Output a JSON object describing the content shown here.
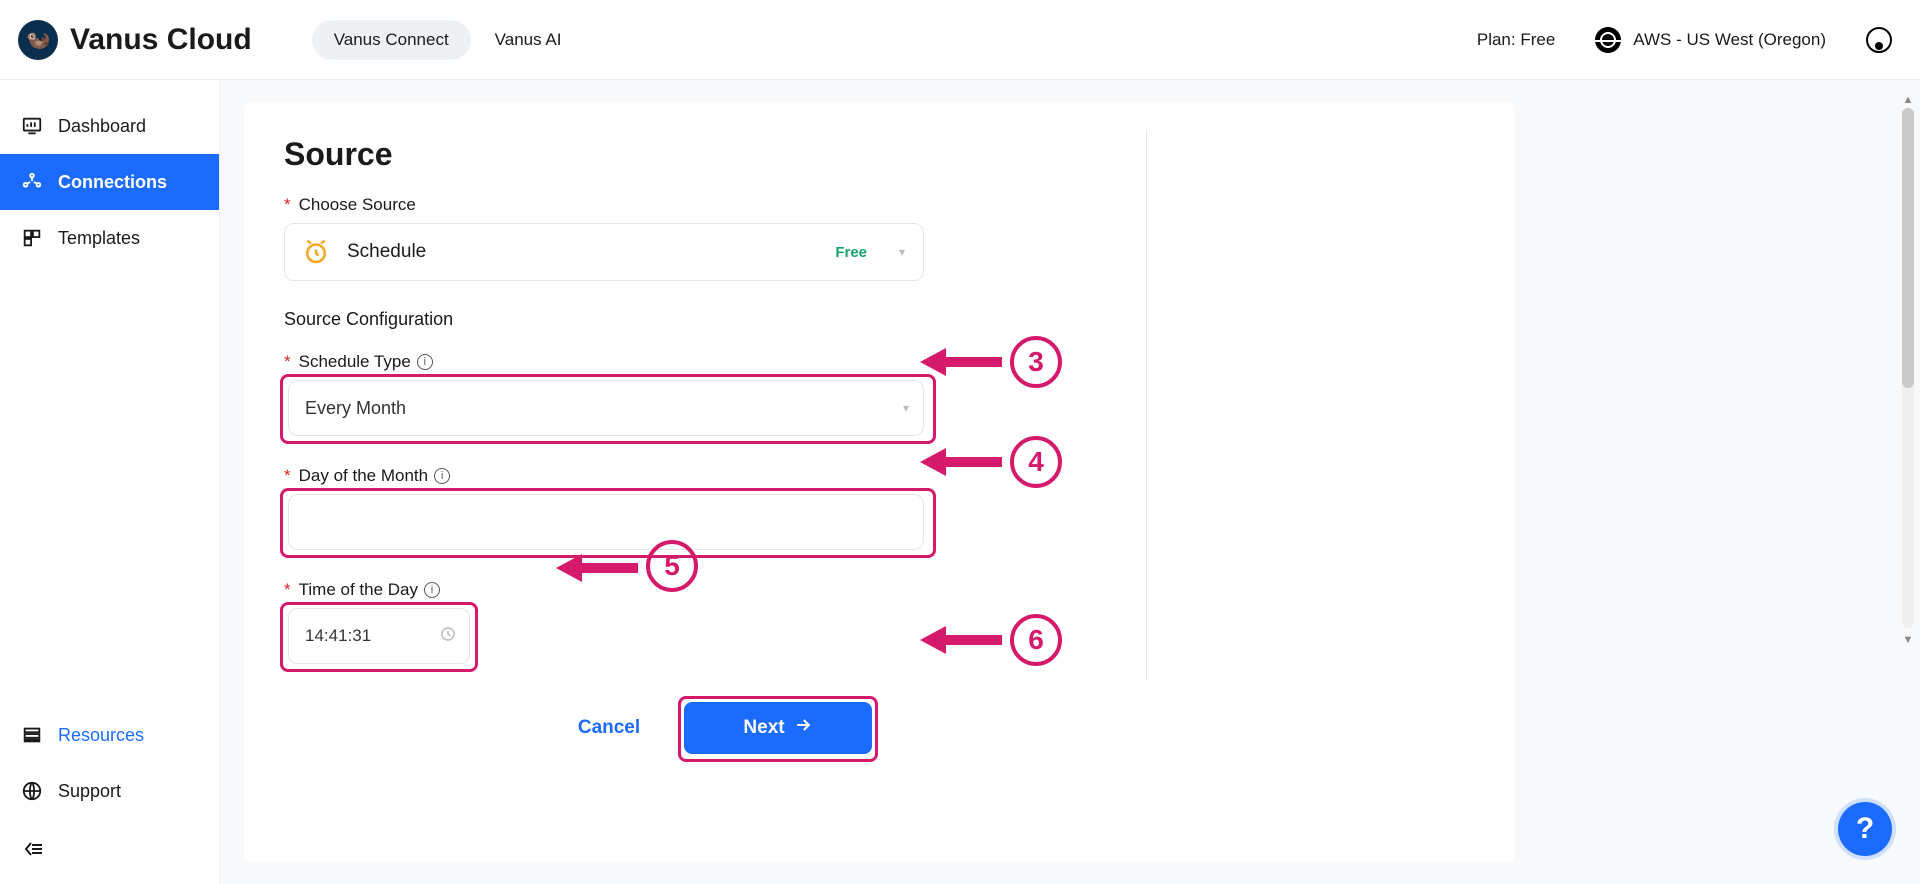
{
  "header": {
    "brand": "Vanus Cloud",
    "nav": {
      "connect": "Vanus Connect",
      "ai": "Vanus AI"
    },
    "plan": "Plan: Free",
    "region": "AWS - US West (Oregon)"
  },
  "sidebar": {
    "items": [
      {
        "label": "Dashboard"
      },
      {
        "label": "Connections"
      },
      {
        "label": "Templates"
      }
    ],
    "bottom": [
      {
        "label": "Resources"
      },
      {
        "label": "Support"
      }
    ]
  },
  "page": {
    "title": "Source",
    "choose_label": "Choose Source",
    "source": {
      "name": "Schedule",
      "badge": "Free"
    },
    "config_head": "Source Configuration",
    "schedule_type": {
      "label": "Schedule Type",
      "value": "Every Month"
    },
    "day_of_month": {
      "label": "Day of the Month",
      "value": ""
    },
    "time_of_day": {
      "label": "Time of the Day",
      "value": "14:41:31"
    },
    "buttons": {
      "cancel": "Cancel",
      "next": "Next"
    }
  },
  "annotations": {
    "n3": "3",
    "n4": "4",
    "n5": "5",
    "n6": "6"
  },
  "help": "?"
}
